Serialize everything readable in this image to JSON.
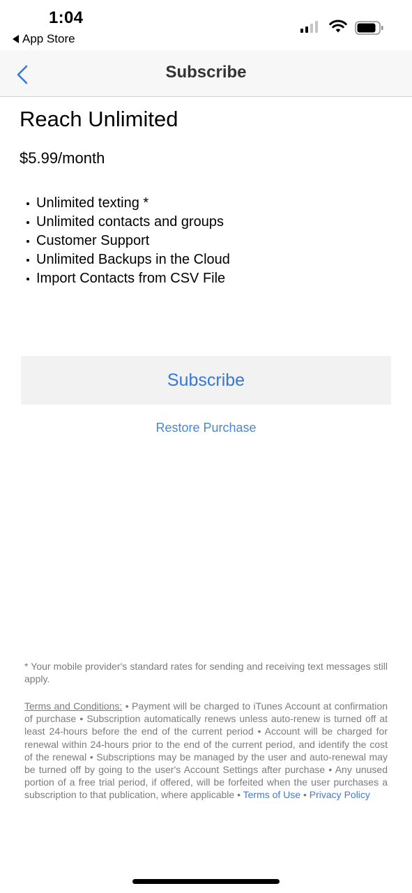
{
  "status_bar": {
    "time": "1:04",
    "back_app_label": "App Store",
    "signal_icon": "cellular-signal-icon",
    "wifi_icon": "wifi-icon",
    "battery_icon": "battery-icon"
  },
  "nav": {
    "back_icon": "chevron-left-icon",
    "title": "Subscribe"
  },
  "plan": {
    "name": "Reach Unlimited",
    "price": "$5.99/month",
    "features": [
      "Unlimited texting *",
      "Unlimited contacts and groups",
      "Customer Support",
      "Unlimited Backups in the Cloud",
      "Import Contacts from CSV File"
    ]
  },
  "actions": {
    "subscribe_label": "Subscribe",
    "restore_label": "Restore Purchase"
  },
  "legal": {
    "footnote": "* Your mobile provider's standard rates for sending and receiving text messages still apply.",
    "terms_label": "Terms and Conditions:",
    "terms_body": " • Payment will be charged to iTunes Account at confirmation of purchase • Subscription automatically renews unless auto-renew is turned off at least 24-hours before the end of the current period • Account will be charged for renewal within 24-hours prior to the end of the current period, and identify the cost of the renewal • Subscriptions may be managed by the user and auto-renewal may be turned off by going to the user's Account Settings after purchase • Any unused portion of a free trial period, if offered, will be forfeited when the user purchases a subscription to that publication, where applicable • ",
    "terms_of_use_link": "Terms of Use",
    "separator": " • ",
    "privacy_policy_link": "Privacy Policy"
  },
  "colors": {
    "accent": "#3478d8",
    "link": "#3f7bd3",
    "nav_background": "#f7f7f7",
    "button_background": "#f2f2f2",
    "legal_text": "#7b7b7b"
  }
}
